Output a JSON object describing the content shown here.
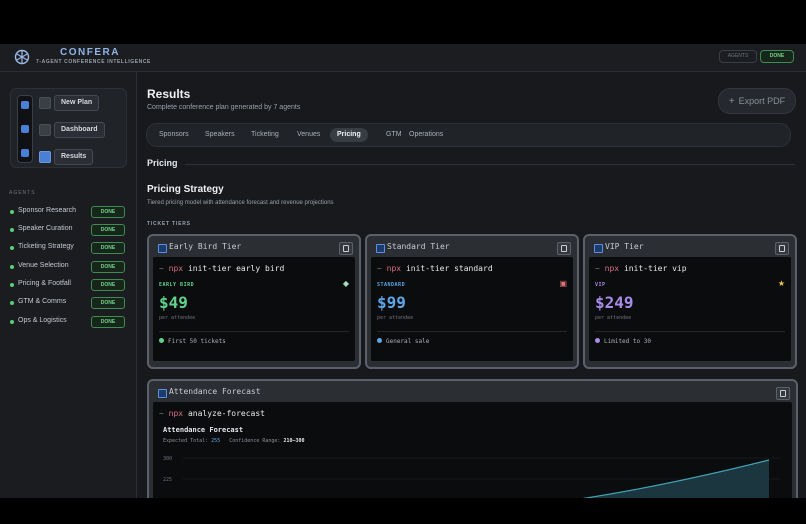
{
  "header": {
    "brand": "CONFERA",
    "tagline": "7-AGENT CONFERENCE INTELLIGENCE",
    "agent_chip": "AGENTS",
    "status_chip": "DONE"
  },
  "sidebar": {
    "steps": [
      {
        "label": "New Plan",
        "active": false
      },
      {
        "label": "Dashboard",
        "active": false
      },
      {
        "label": "Results",
        "active": true
      }
    ],
    "agents_label": "AGENTS",
    "agents": [
      {
        "name": "Sponsor Research",
        "status": "DONE"
      },
      {
        "name": "Speaker Curation",
        "status": "DONE"
      },
      {
        "name": "Ticketing Strategy",
        "status": "DONE"
      },
      {
        "name": "Venue Selection",
        "status": "DONE"
      },
      {
        "name": "Pricing & Footfall",
        "status": "DONE"
      },
      {
        "name": "GTM & Comms",
        "status": "DONE"
      },
      {
        "name": "Ops & Logistics",
        "status": "DONE"
      }
    ]
  },
  "main": {
    "title": "Results",
    "subtitle": "Complete conference plan generated by 7 agents",
    "export_label": "Export PDF",
    "tabs": [
      "Sponsors",
      "Speakers",
      "Ticketing",
      "Venues",
      "Pricing",
      "GTM",
      "Operations"
    ],
    "active_tab": "Pricing",
    "section_heading": "Pricing",
    "strategy_title": "Pricing Strategy",
    "strategy_subtitle": "Tiered pricing model with attendance forecast and revenue projections",
    "tiers_label": "TICKET TIERS",
    "tiers": [
      {
        "title": "Early Bird Tier",
        "prompt": "~",
        "npx": "npx",
        "command": "init-tier early bird",
        "tag": "EARLY BIRD",
        "emblem": "◆",
        "price": "$49",
        "per": "per attendee",
        "note": "First 50 tickets",
        "color": "#5fd38b"
      },
      {
        "title": "Standard Tier",
        "prompt": "~",
        "npx": "npx",
        "command": "init-tier standard",
        "tag": "STANDARD",
        "emblem": "▣",
        "price": "$99",
        "per": "per attendee",
        "note": "General sale",
        "color": "#5ea7e6"
      },
      {
        "title": "VIP Tier",
        "prompt": "~",
        "npx": "npx",
        "command": "init-tier vip",
        "tag": "VIP",
        "emblem": "★",
        "price": "$249",
        "per": "per attendee",
        "note": "Limited to 30",
        "color": "#a98be8"
      }
    ],
    "forecast": {
      "panel_title": "Attendance Forecast",
      "prompt": "~",
      "npx": "npx",
      "command": "analyze-forecast",
      "chart_title": "Attendance Forecast",
      "expected_label": "Expected Total:",
      "expected_value": "255",
      "range_label": "Confidence Range:",
      "range_value": "210–300",
      "y_ticks": [
        "300",
        "225"
      ]
    }
  }
}
